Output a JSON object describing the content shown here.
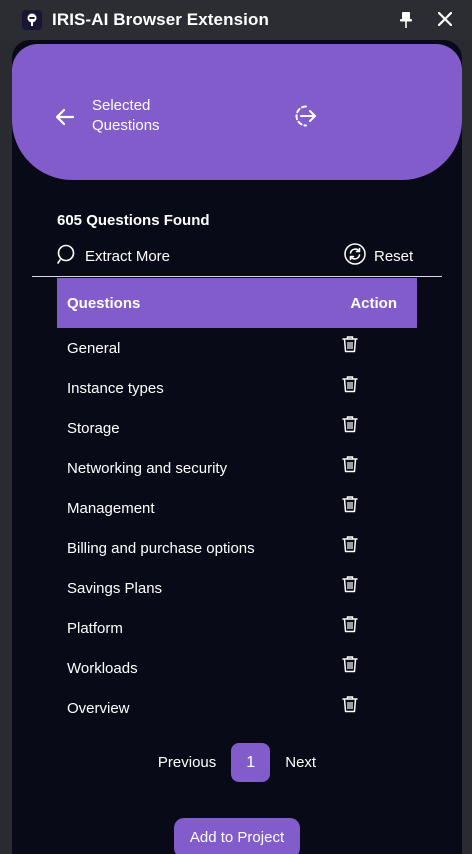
{
  "window": {
    "title": "IRIS-AI Browser Extension"
  },
  "header": {
    "title": "Selected Questions"
  },
  "summary": {
    "found": "605 Questions Found"
  },
  "actions": {
    "extract_more": "Extract More",
    "reset": "Reset"
  },
  "table": {
    "headers": [
      "Questions",
      "Action"
    ],
    "rows": [
      "General",
      "Instance types",
      "Storage",
      "Networking and security",
      "Management",
      "Billing and purchase options",
      "Savings Plans",
      "Platform",
      "Workloads",
      "Overview"
    ]
  },
  "pagination": {
    "previous": "Previous",
    "current": "1",
    "next": "Next"
  },
  "footer": {
    "add_to_project": "Add to Project"
  },
  "colors": {
    "accent": "#825cca",
    "panel": "#080a17",
    "chrome": "#2c2d32"
  }
}
